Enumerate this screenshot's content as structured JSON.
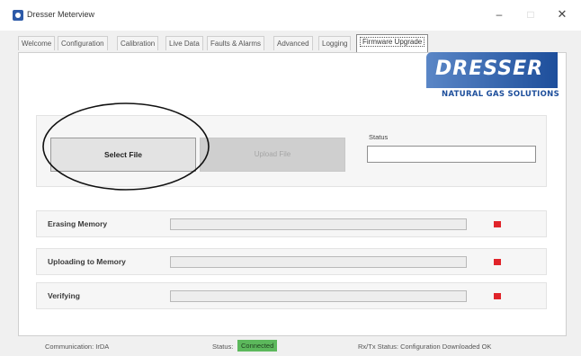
{
  "window": {
    "title": "Dresser Meterview",
    "minimize_glyph": "–",
    "maximize_glyph": "□",
    "close_glyph": "✕"
  },
  "tabs": [
    {
      "label": "Welcome"
    },
    {
      "label": "Configuration"
    },
    {
      "label": "Calibration"
    },
    {
      "label": "Live Data"
    },
    {
      "label": "Faults & Alarms"
    },
    {
      "label": "Advanced"
    },
    {
      "label": "Logging"
    },
    {
      "label": "Firmware Upgrade",
      "active": true
    }
  ],
  "logo": {
    "word": "DRESSER",
    "subtitle": "NATURAL GAS SOLUTIONS"
  },
  "file_section": {
    "select_label": "Select File",
    "upload_label": "Upload File",
    "status_label": "Status",
    "status_value": ""
  },
  "progress_rows": [
    {
      "label": "Erasing Memory",
      "progress": 0,
      "indicator_color": "#e0242a"
    },
    {
      "label": "Uploading to Memory",
      "progress": 0,
      "indicator_color": "#e0242a"
    },
    {
      "label": "Verifying",
      "progress": 0,
      "indicator_color": "#e0242a"
    }
  ],
  "statusbar": {
    "communication": "Communication: IrDA",
    "status_label": "Status:",
    "status_value": "Connected",
    "rxtx": "Rx/Tx Status: Configuration Downloaded OK"
  }
}
